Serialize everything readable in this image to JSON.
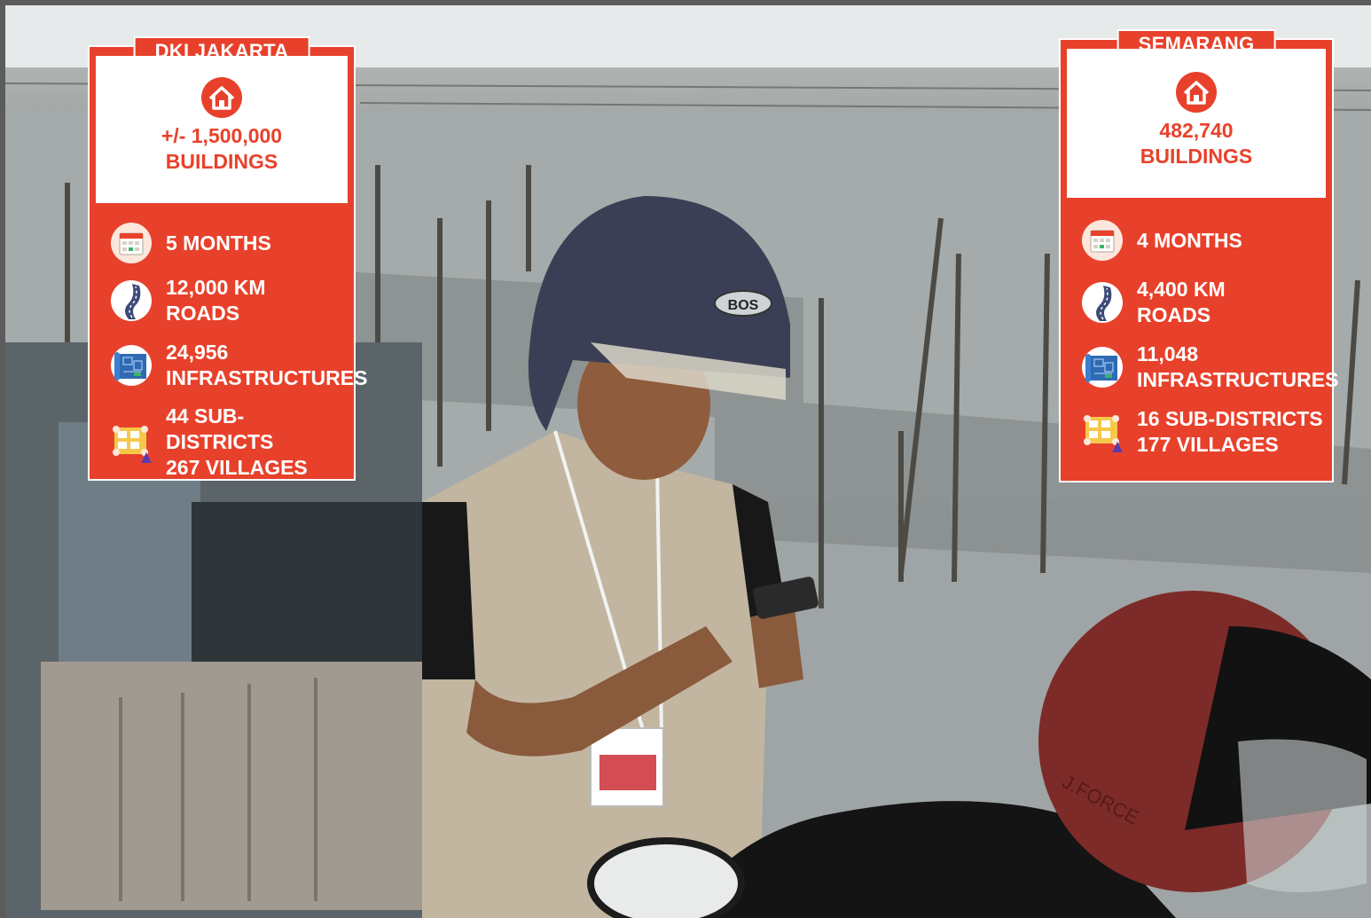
{
  "cards": [
    {
      "title": "DKI JAKARTA",
      "buildings_value": "+/- 1,500,000",
      "buildings_label": "BUILDINGS",
      "rows": [
        {
          "icon": "calendar-icon",
          "line1": "5 MONTHS",
          "line2": ""
        },
        {
          "icon": "road-icon",
          "line1": "12,000 KM",
          "line2": "ROADS"
        },
        {
          "icon": "blueprint-map-icon",
          "line1": "24,956",
          "line2": "INFRASTRUCTURES"
        },
        {
          "icon": "village-map-icon",
          "line1": "44 SUB-DISTRICTS",
          "line2": "267 VILLAGES"
        }
      ]
    },
    {
      "title": "SEMARANG",
      "buildings_value": "482,740",
      "buildings_label": "BUILDINGS",
      "rows": [
        {
          "icon": "calendar-icon",
          "line1": "4 MONTHS",
          "line2": ""
        },
        {
          "icon": "road-icon",
          "line1": "4,400 KM",
          "line2": "ROADS"
        },
        {
          "icon": "blueprint-map-icon",
          "line1": "11,048",
          "line2": "INFRASTRUCTURES"
        },
        {
          "icon": "village-map-icon",
          "line1": "16 SUB-DISTRICTS",
          "line2": "177 VILLAGES"
        }
      ]
    }
  ],
  "colors": {
    "card_red": "#e8412b",
    "card_white": "#ffffff"
  },
  "photo_text": {
    "helmet_brand": "BOS",
    "helmet_text_right": "J.FORCE"
  }
}
